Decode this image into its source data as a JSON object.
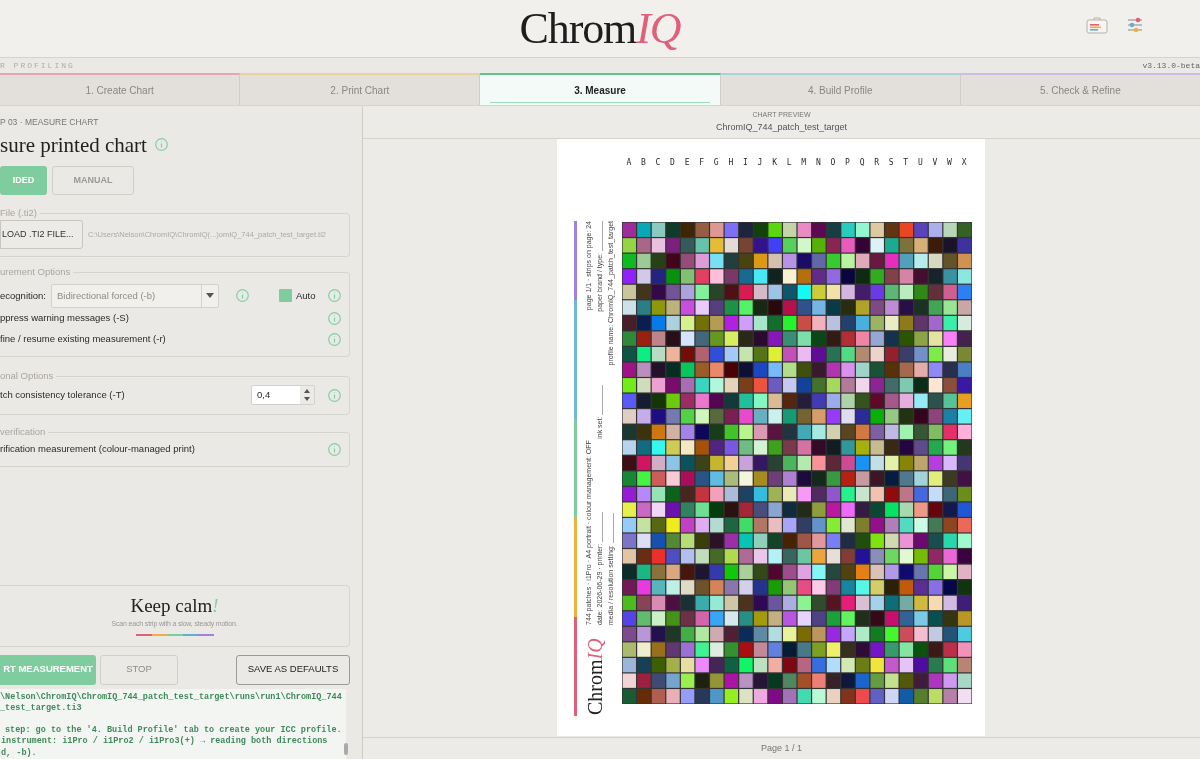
{
  "header": {
    "logo_main": "Chrom",
    "logo_accent": "IQ"
  },
  "subheader": {
    "left": "R PROFILING",
    "version": "v3.13.0-beta"
  },
  "tabs": [
    {
      "label": "1. Create Chart",
      "selected": false,
      "color": "#e8a4b4"
    },
    {
      "label": "2. Print Chart",
      "selected": false,
      "color": "#ead29a"
    },
    {
      "label": "3. Measure",
      "selected": true,
      "color": "#5cc48e"
    },
    {
      "label": "4. Build Profile",
      "selected": false,
      "color": "#a9d3dc"
    },
    {
      "label": "5. Check & Refine",
      "selected": false,
      "color": "#cbbde4"
    }
  ],
  "panel": {
    "step": "P 03 · MEASURE CHART",
    "title": "sure printed chart",
    "modes": [
      {
        "label": "IDED",
        "selected": true
      },
      {
        "label": "MANUAL",
        "selected": false
      }
    ],
    "file_group": {
      "legend": "File (.ti2)",
      "button": "LOAD .TI2 FILE...",
      "path": "C:\\Users\\Nelson\\ChromIQ\\ChromIQ(...)omIQ_744_patch_test_target.ti2"
    },
    "measurement_group": {
      "legend": "urement Options",
      "recognition": {
        "label": "ecognition:",
        "value": "Bidirectional forced (-b)",
        "disabled": true
      },
      "auto": {
        "label": "Auto",
        "checked": true
      },
      "options": [
        "ppress warning messages (-S)",
        "fine / resume existing measurement (-r)"
      ]
    },
    "optional_group": {
      "legend": "onal Options",
      "label": "tch consistency tolerance (-T)",
      "value": "0,4"
    },
    "verification_group": {
      "legend": "verification",
      "label": "rification measurement (colour-managed print)"
    },
    "tip": {
      "title": "Keep calm",
      "mark": "!",
      "text": "Scan each strip with a slow, steady motion."
    },
    "actions": [
      {
        "label": "RT MEASUREMENT",
        "kind": "primary"
      },
      {
        "label": "STOP",
        "kind": "disabled"
      },
      {
        "label": "SAVE AS DEFAULTS",
        "kind": "outline"
      }
    ],
    "log": [
      "\\Nelson\\ChromIQ\\ChromIQ_744_patch_test_target\\runs\\run1\\ChromIQ_744",
      "_test_target.ti3",
      "step: go to the '4. Build Profile' tab to create your ICC profile.",
      "instrument: i1Pro / i1Pro2 / i1Pro3(+) → reading both directions",
      "d, -b)."
    ]
  },
  "preview": {
    "caption": "CHART PREVIEW",
    "filename": "ChromIQ_744_patch_test_target",
    "columns": [
      "A",
      "B",
      "C",
      "D",
      "E",
      "F",
      "G",
      "H",
      "I",
      "J",
      "K",
      "L",
      "M",
      "N",
      "O",
      "P",
      "Q",
      "R",
      "S",
      "T",
      "U",
      "V",
      "W",
      "X"
    ],
    "notes": [
      [
        {
          "text": "744 patches · i1Pro · A4 portrait · colour management: OFF"
        },
        {
          "text": "page 1/1 · strips on page: 24"
        }
      ],
      [
        {
          "text": "date: 2026-06-29 · printer:",
          "line": true
        },
        {
          "text": "ink set:",
          "line": true
        },
        {
          "text": "paper brand / type:",
          "line": true
        }
      ],
      [
        {
          "text": "media / resolution setting:",
          "line": true
        },
        {
          "text": "profile name: ChromIQ_744_patch_test_target"
        }
      ]
    ],
    "logo_main": "Chrom",
    "logo_accent": "IQ",
    "footer": "Page 1 / 1"
  }
}
